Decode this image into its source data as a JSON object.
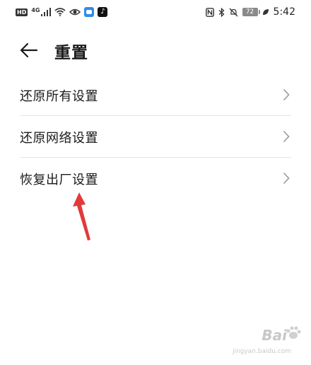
{
  "status_bar": {
    "hd_badge": "HD",
    "network": "4G",
    "battery": "72",
    "time": "5:42",
    "icons": [
      "hd-icon",
      "signal-icon",
      "wifi-icon",
      "eye-icon",
      "app-icon",
      "tiktok-icon",
      "nfc-icon",
      "bluetooth-icon",
      "mute-icon",
      "battery-icon",
      "leaf-icon"
    ]
  },
  "header": {
    "back_icon": "back-arrow-icon",
    "title": "重置"
  },
  "settings_list": [
    {
      "label": "还原所有设置",
      "icon": "chevron-right-icon"
    },
    {
      "label": "还原网络设置",
      "icon": "chevron-right-icon"
    },
    {
      "label": "恢复出厂设置",
      "icon": "chevron-right-icon"
    }
  ],
  "annotation": {
    "icon": "red-arrow-annotation",
    "color": "#e23a3a"
  },
  "watermark": {
    "text": "Bai",
    "subtext": "jingyan.baidu.com"
  },
  "colors": {
    "text": "#1a1a1a",
    "divider": "#e4e4e4",
    "chevron": "#9a9a9a"
  }
}
